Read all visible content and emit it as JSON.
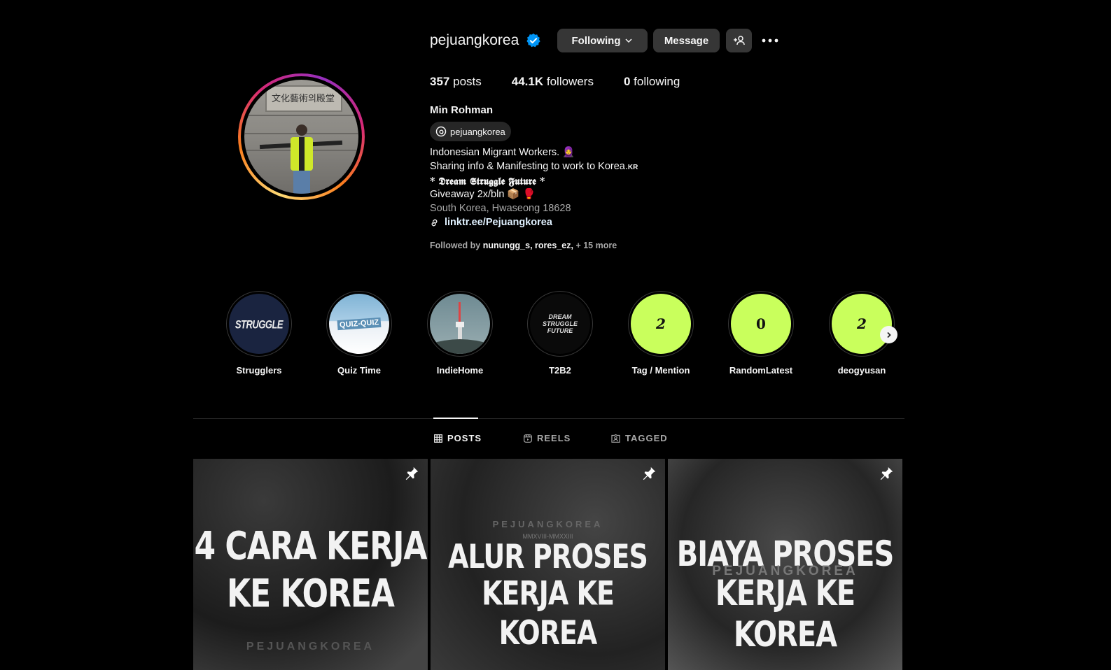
{
  "profile": {
    "username": "pejuangkorea",
    "following_label": "Following",
    "message_label": "Message",
    "stats": {
      "posts_count": "357",
      "posts_label": "posts",
      "followers_count": "44.1K",
      "followers_label": "followers",
      "following_count": "0",
      "following_label": "following"
    },
    "full_name": "Min Rohman",
    "threads_handle": "pejuangkorea",
    "bio": {
      "line1": "Indonesian Migrant Workers. 🧕",
      "line2": "Sharing info & Manifesting to work to Korea.",
      "line2_flag": "KR",
      "line3": "* 𝕯𝖗𝖊𝖆𝖒 𝕾𝖙𝖗𝖚𝖌𝖌𝖑𝖊 𝕱𝖚𝖙𝖚𝖗𝖊 *",
      "line4": "Giveaway 2x/bln 📦 🥊",
      "location": "South Korea, Hwaseong 18628",
      "link": "linktr.ee/Pejuangkorea"
    },
    "followed_by": {
      "prefix": "Followed by",
      "user1": "nunungg_s",
      "user2": "rores_ez",
      "more": "+ 15 more"
    },
    "avatar_sign": "文化藝術의殿堂"
  },
  "highlights": [
    {
      "label": "Strugglers",
      "cover_text": "STRUGGLE"
    },
    {
      "label": "Quiz Time",
      "cover_text": "QUIZ-QUIZ"
    },
    {
      "label": "IndieHome"
    },
    {
      "label": "T2B2",
      "cover_text": "DREAM STRUGGLE FUTURE"
    },
    {
      "label": "Tag / Mention",
      "cover_text": "2"
    },
    {
      "label": "RandomLatest",
      "cover_text": "0"
    },
    {
      "label": "deogyusan",
      "cover_text": "2"
    }
  ],
  "tabs": [
    {
      "label": "POSTS",
      "icon": "grid-icon",
      "active": true
    },
    {
      "label": "REELS",
      "icon": "reels-icon",
      "active": false
    },
    {
      "label": "TAGGED",
      "icon": "tagged-icon",
      "active": false
    }
  ],
  "posts": [
    {
      "line1": "4 CARA KERJA",
      "line2": "KE KOREA",
      "brand": "PEJUANGKOREA",
      "pinned": true
    },
    {
      "line1": "ALUR PROSES",
      "line2": "KERJA KE KOREA",
      "brand": "PEJUANGKOREA",
      "sub": "MMXVIII-MMXXIII",
      "pinned": true
    },
    {
      "line1": "BIAYA PROSES",
      "line2": "KERJA KE KOREA",
      "brand": "PEJUANGKOREA",
      "pinned": true
    }
  ],
  "colors": {
    "verified": "#0095f6",
    "button": "#363636",
    "lime": "#c9ff5c",
    "accent_ring_start": "#feda75",
    "accent_ring_end": "#d62976"
  }
}
